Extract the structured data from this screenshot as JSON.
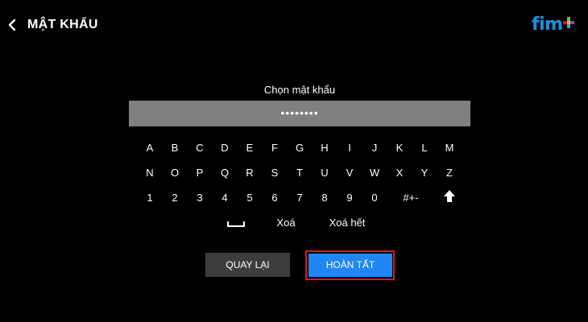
{
  "header": {
    "title": "MẬT KHẨU",
    "back_icon": "chevron-left-icon",
    "logo_text": "fim",
    "logo_colors": [
      "#1e8fe0",
      "#6ec33b",
      "#e6005c",
      "#f6b400",
      "#8b46d8",
      "#19b4e6"
    ]
  },
  "form": {
    "label": "Chọn mật khẩu",
    "password_value": "••••••••"
  },
  "keyboard": {
    "row1": [
      "A",
      "B",
      "C",
      "D",
      "E",
      "F",
      "G",
      "H",
      "I",
      "J",
      "K",
      "L",
      "M"
    ],
    "row2": [
      "N",
      "O",
      "P",
      "Q",
      "R",
      "S",
      "T",
      "U",
      "V",
      "W",
      "X",
      "Y",
      "Z"
    ],
    "row3": [
      "1",
      "2",
      "3",
      "4",
      "5",
      "6",
      "7",
      "8",
      "9",
      "0",
      "#+-"
    ],
    "shift_icon": "arrow-up-icon",
    "space_icon": "space-bar-icon",
    "delete_label": "Xoá",
    "clear_all_label": "Xoá hết"
  },
  "actions": {
    "back_label": "QUAY LẠI",
    "done_label": "HOÀN TẤT"
  },
  "colors": {
    "background": "#000000",
    "input_bg": "#808080",
    "primary_button": "#1f86f2",
    "secondary_button": "#3d3d3d",
    "highlight_border": "#e0141e"
  }
}
